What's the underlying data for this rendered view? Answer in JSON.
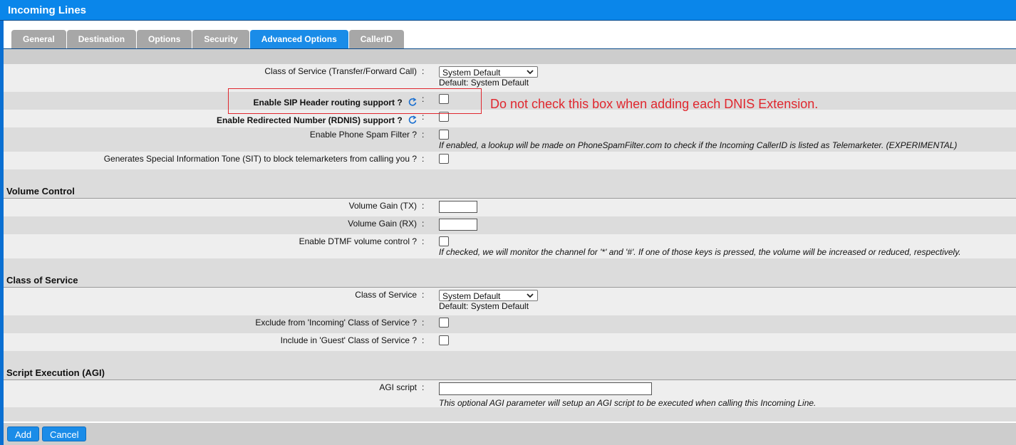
{
  "window": {
    "title": "Incoming Lines"
  },
  "tabs": [
    {
      "label": "General",
      "active": false
    },
    {
      "label": "Destination",
      "active": false
    },
    {
      "label": "Options",
      "active": false
    },
    {
      "label": "Security",
      "active": false
    },
    {
      "label": "Advanced Options",
      "active": true
    },
    {
      "label": "CallerID",
      "active": false
    }
  ],
  "advanced": {
    "cos_transfer": {
      "label": "Class of Service (Transfer/Forward Call)",
      "value": "System Default",
      "default": "Default: System Default"
    },
    "sip_header": {
      "label": "Enable SIP Header routing support ?",
      "checked": false
    },
    "rdnis": {
      "label": "Enable Redirected Number (RDNIS) support ?",
      "checked": false
    },
    "spam": {
      "label": "Enable Phone Spam Filter ?",
      "checked": false,
      "note": "If enabled, a lookup will be made on PhoneSpamFilter.com to check if the Incoming CallerID is listed as Telemarketer. (EXPERIMENTAL)"
    },
    "sit": {
      "label": "Generates Special Information Tone (SIT) to block telemarketers from calling you ?",
      "checked": false
    }
  },
  "volume": {
    "heading": "Volume Control",
    "gain_tx": {
      "label": "Volume Gain (TX)",
      "value": ""
    },
    "gain_rx": {
      "label": "Volume Gain (RX)",
      "value": ""
    },
    "dtmf": {
      "label": "Enable DTMF volume control ?",
      "checked": false,
      "note": "If checked, we will monitor the channel for '*' and '#'. If one of those keys is pressed, the volume will be increased or reduced, respectively."
    }
  },
  "cos": {
    "heading": "Class of Service",
    "class": {
      "label": "Class of Service",
      "value": "System Default",
      "default": "Default: System Default"
    },
    "exclude_incoming": {
      "label": "Exclude from 'Incoming' Class of Service ?",
      "checked": false
    },
    "include_guest": {
      "label": "Include in 'Guest' Class of Service ?",
      "checked": false
    }
  },
  "agi": {
    "heading": "Script Execution (AGI)",
    "script": {
      "label": "AGI script",
      "value": "",
      "note": "This optional AGI parameter will setup an AGI script to be executed when calling this Incoming Line."
    }
  },
  "colon": ":",
  "buttons": {
    "add": "Add",
    "cancel": "Cancel"
  },
  "annotation": {
    "text": "Do not check this box when adding each DNIS Extension."
  },
  "colors": {
    "accent": "#0a86ea",
    "tab_active": "#1a8ce8",
    "tab_inactive": "#a7a7a7",
    "annotation": "#e0272e"
  }
}
